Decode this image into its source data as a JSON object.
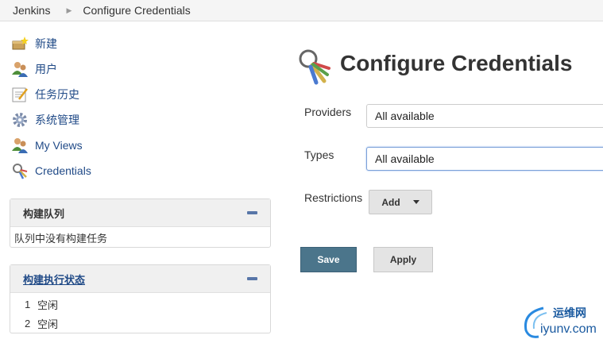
{
  "breadcrumb": {
    "root": "Jenkins",
    "current": "Configure Credentials"
  },
  "sidebar": {
    "items": [
      {
        "label": "新建",
        "icon": "new-item-icon"
      },
      {
        "label": "用户",
        "icon": "users-icon"
      },
      {
        "label": "任务历史",
        "icon": "build-history-icon"
      },
      {
        "label": "系统管理",
        "icon": "gear-icon"
      },
      {
        "label": "My Views",
        "icon": "users-icon"
      },
      {
        "label": "Credentials",
        "icon": "keys-icon"
      }
    ]
  },
  "build_queue": {
    "title": "构建队列",
    "empty_text": "队列中没有构建任务"
  },
  "executors": {
    "title": "构建执行状态",
    "rows": [
      {
        "num": "1",
        "status": "空闲"
      },
      {
        "num": "2",
        "status": "空闲"
      }
    ]
  },
  "main": {
    "title": "Configure Credentials",
    "providers_label": "Providers",
    "providers_value": "All available",
    "types_label": "Types",
    "types_value": "All available",
    "restrictions_label": "Restrictions",
    "add_label": "Add",
    "save_label": "Save",
    "apply_label": "Apply"
  },
  "watermark": {
    "cn": "运维网",
    "en": "iyunv.com"
  },
  "colors": {
    "link": "#204a87",
    "save_button": "#4b758b",
    "focus_border": "#7aa0d8"
  }
}
